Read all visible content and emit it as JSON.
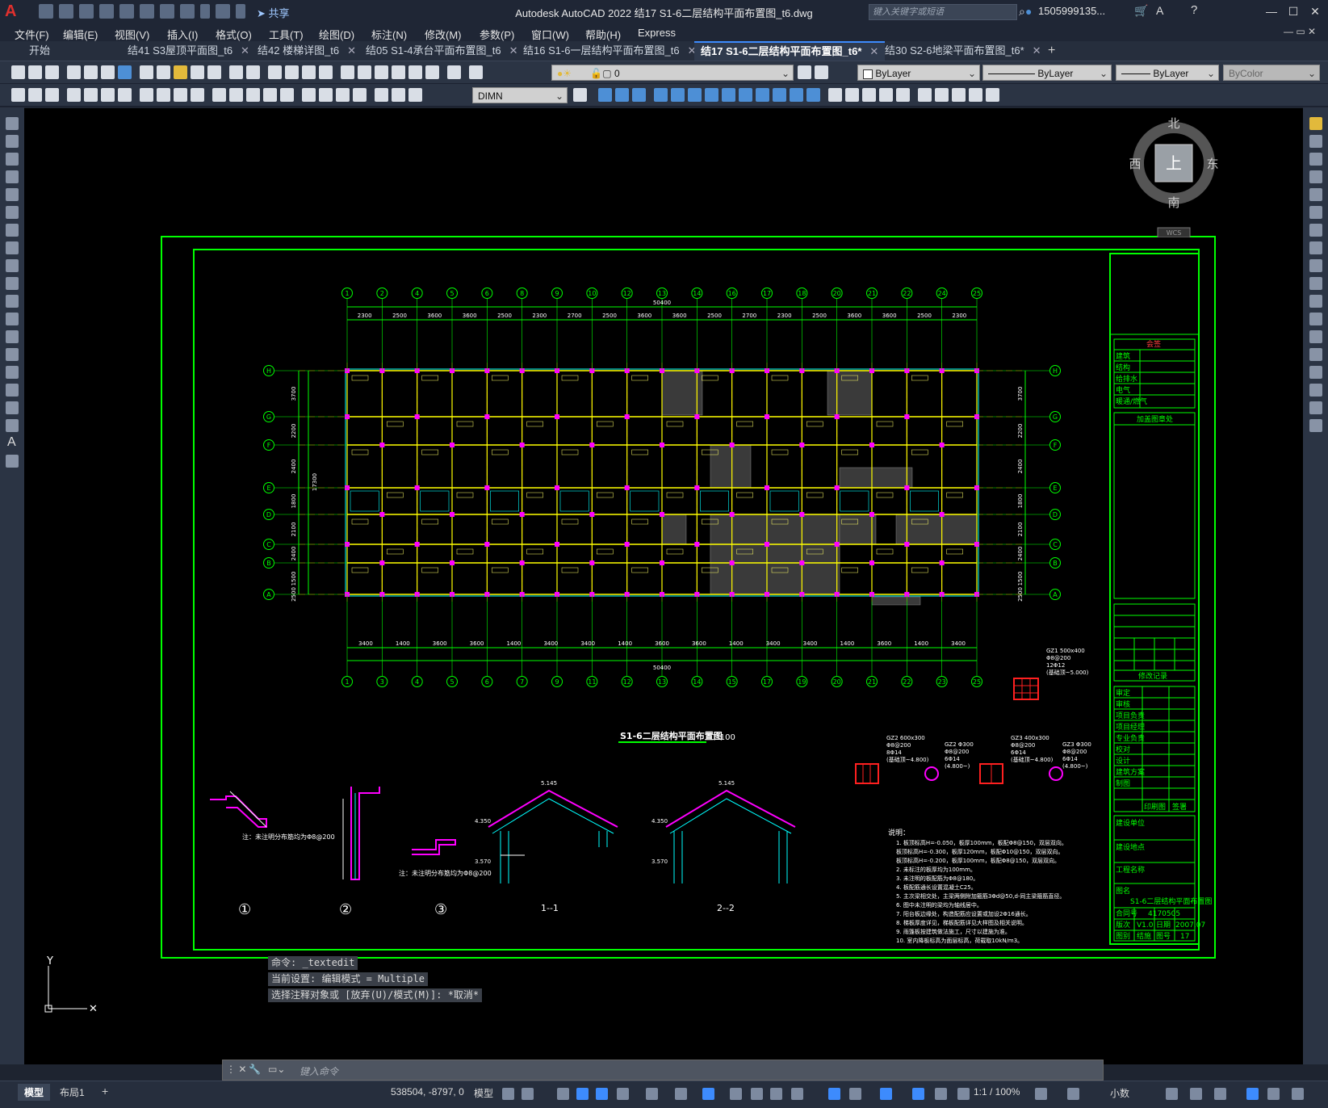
{
  "app": {
    "title": "Autodesk AutoCAD 2022    结17 S1-6二层结构平面布置图_t6.dwg",
    "share_label": "共享",
    "search_placeholder": "键入关键字或短语",
    "user": "1505999135...",
    "logo": "A"
  },
  "menu": [
    "文件(F)",
    "编辑(E)",
    "视图(V)",
    "插入(I)",
    "格式(O)",
    "工具(T)",
    "绘图(D)",
    "标注(N)",
    "修改(M)",
    "参数(P)",
    "窗口(W)",
    "帮助(H)",
    "Express"
  ],
  "tabs": [
    {
      "label": "开始",
      "active": false,
      "close": false
    },
    {
      "label": "结41 S3屋顶平面图_t6",
      "active": false,
      "close": true
    },
    {
      "label": "结42 楼梯详图_t6",
      "active": false,
      "close": true
    },
    {
      "label": "结05 S1-4承台平面布置图_t6",
      "active": false,
      "close": true
    },
    {
      "label": "结16 S1-6一层结构平面布置图_t6",
      "active": false,
      "close": true
    },
    {
      "label": "结17 S1-6二层结构平面布置图_t6*",
      "active": true,
      "close": true
    },
    {
      "label": "结30 S2-6地梁平面布置图_t6*",
      "active": false,
      "close": true
    }
  ],
  "toolbar": {
    "layer_value": "0",
    "color_value": "ByLayer",
    "linetype_value": "ByLayer",
    "lineweight_value": "ByLayer",
    "plotstyle_value": "ByColor",
    "dimstyle_value": "DIMN"
  },
  "viewcube": {
    "north": "北",
    "south": "南",
    "east": "东",
    "west": "西",
    "face": "上",
    "wcs": "WCS"
  },
  "drawing": {
    "plan_title": "S1-6二层结构平面布置图",
    "plan_scale": "1:100",
    "top_axes": [
      "1",
      "2",
      "4",
      "5",
      "6",
      "8",
      "9",
      "10",
      "12",
      "13",
      "14",
      "16",
      "17",
      "18",
      "20",
      "21",
      "22",
      "24",
      "25"
    ],
    "bottom_axes": [
      "1",
      "3",
      "4",
      "5",
      "6",
      "7",
      "9",
      "11",
      "12",
      "13",
      "14",
      "15",
      "17",
      "19",
      "20",
      "21",
      "22",
      "23",
      "25"
    ],
    "row_axes": [
      "H",
      "G",
      "F",
      "E",
      "D",
      "C",
      "B",
      "A"
    ],
    "top_dims": [
      "2300",
      "2500",
      "3600",
      "3600",
      "2500",
      "2300",
      "2700",
      "2500",
      "3600",
      "3600",
      "2500",
      "2700",
      "2300",
      "2500",
      "3600",
      "3600",
      "2500",
      "2300"
    ],
    "bottom_dims": [
      "3400",
      "1400",
      "3600",
      "3600",
      "1400",
      "3400",
      "3400",
      "1400",
      "3600",
      "3600",
      "1400",
      "3400",
      "3400",
      "1400",
      "3600",
      "1400",
      "3400"
    ],
    "overall_dim": "50400",
    "left_dims": [
      "3700",
      "2200",
      "2400",
      "1800",
      "2100",
      "2400",
      "1500",
      "2500"
    ],
    "left_total": "17300",
    "details": [
      "①",
      "②",
      "③",
      "1--1",
      "2--2"
    ],
    "detail_notes": [
      "注：未注明分布筋均为Φ8@200",
      "注：未注明分布筋均为Φ8@200"
    ],
    "elevations": [
      "5.145",
      "4.350",
      "3.570",
      "5.145",
      "4.350",
      "3.570"
    ],
    "column_tags": [
      {
        "name": "GZ1 500x400",
        "spec": "Φ8@200",
        "bars": "12Φ12",
        "note": "(基础顶~5.000)"
      },
      {
        "name": "GZ2 600x300",
        "spec": "Φ8@200",
        "bars": "8Φ14",
        "note": "(基础顶~4.800)"
      },
      {
        "name": "GZ2 Φ300",
        "spec": "Φ8@200",
        "bars": "6Φ14",
        "note": "(4.800~)"
      },
      {
        "name": "GZ3 400x300",
        "spec": "Φ8@200",
        "bars": "6Φ14",
        "note": "(基础顶~4.800)"
      },
      {
        "name": "GZ3 Φ300",
        "spec": "Φ8@200",
        "bars": "6Φ14",
        "note": "(4.800~)"
      }
    ],
    "notes_title": "说明：",
    "notes": [
      "1.     板顶标高H=-0.050，板厚100mm，板配Φ8@150，双层双向。",
      "       板顶标高H=-0.300，板厚120mm，板配Φ10@150，双层双向。",
      "       板顶标高H=-0.200，板厚100mm，板配Φ8@150，双层双向。",
      "2. 未标注的板厚均为100mm。",
      "3. 未注明的板配筋为Φ8@180。",
      "4. 板配筋通长设置混凝土C25。",
      "5. 主次梁相交处，主梁两侧附加箍筋3Φd@50,d-同主梁箍筋直径。",
      "6. 图中未注明的梁均为轴线居中。",
      "7. 阳台板边缘处，构造配筋应设置或加设2Φ16通长。",
      "8. 梯板厚度详见，梯板配筋详见大样图及相关说明。",
      "9. 雨篷板按建筑做法施工，尺寸以建施为准。",
      "10. 室内降板标高为面层标高，荷载取10kN/m3。"
    ],
    "title_block": {
      "header": "会签",
      "disciplines": [
        "建筑",
        "结构",
        "给排水",
        "电气",
        "暖通/燃气"
      ],
      "stamp": "加盖图章处",
      "revisions": "修改记录",
      "roles": [
        "审定",
        "审核",
        "项目负责",
        "项目经理",
        "专业负责",
        "校对",
        "设计",
        "建筑方案",
        "制图"
      ],
      "print_label": "印刷图",
      "sign_label": "签署",
      "client": "建设单位",
      "location": "建设地点",
      "project": "工程名称",
      "drawing_name_label": "图名",
      "drawing_name": "S1-6二层结构平面布置图",
      "contract_label": "合同号",
      "contract": "4170505",
      "version_label": "版次",
      "version": "V1.0",
      "date_label": "日期",
      "date": "2007.07",
      "category_label": "图别",
      "category": "结施",
      "sheet_label": "图号",
      "sheet": "17"
    }
  },
  "command": {
    "history": [
      "命令: _textedit",
      "当前设置: 编辑模式 = Multiple",
      "选择注释对象或 [放弃(U)/模式(M)]: *取消*"
    ],
    "placeholder": "键入命令"
  },
  "status": {
    "tabs": [
      "模型",
      "布局1"
    ],
    "coords": "538504, -8797, 0",
    "model_label": "模型",
    "scale": "1:1 / 100%",
    "units": "小数"
  },
  "colors": {
    "canvas": "#000000",
    "frame": "#00ff00",
    "axis": "#00ff00",
    "beam": "#ffff00",
    "column": "#ff00ff",
    "center": "#ff0000",
    "slab": "#00ffff"
  }
}
